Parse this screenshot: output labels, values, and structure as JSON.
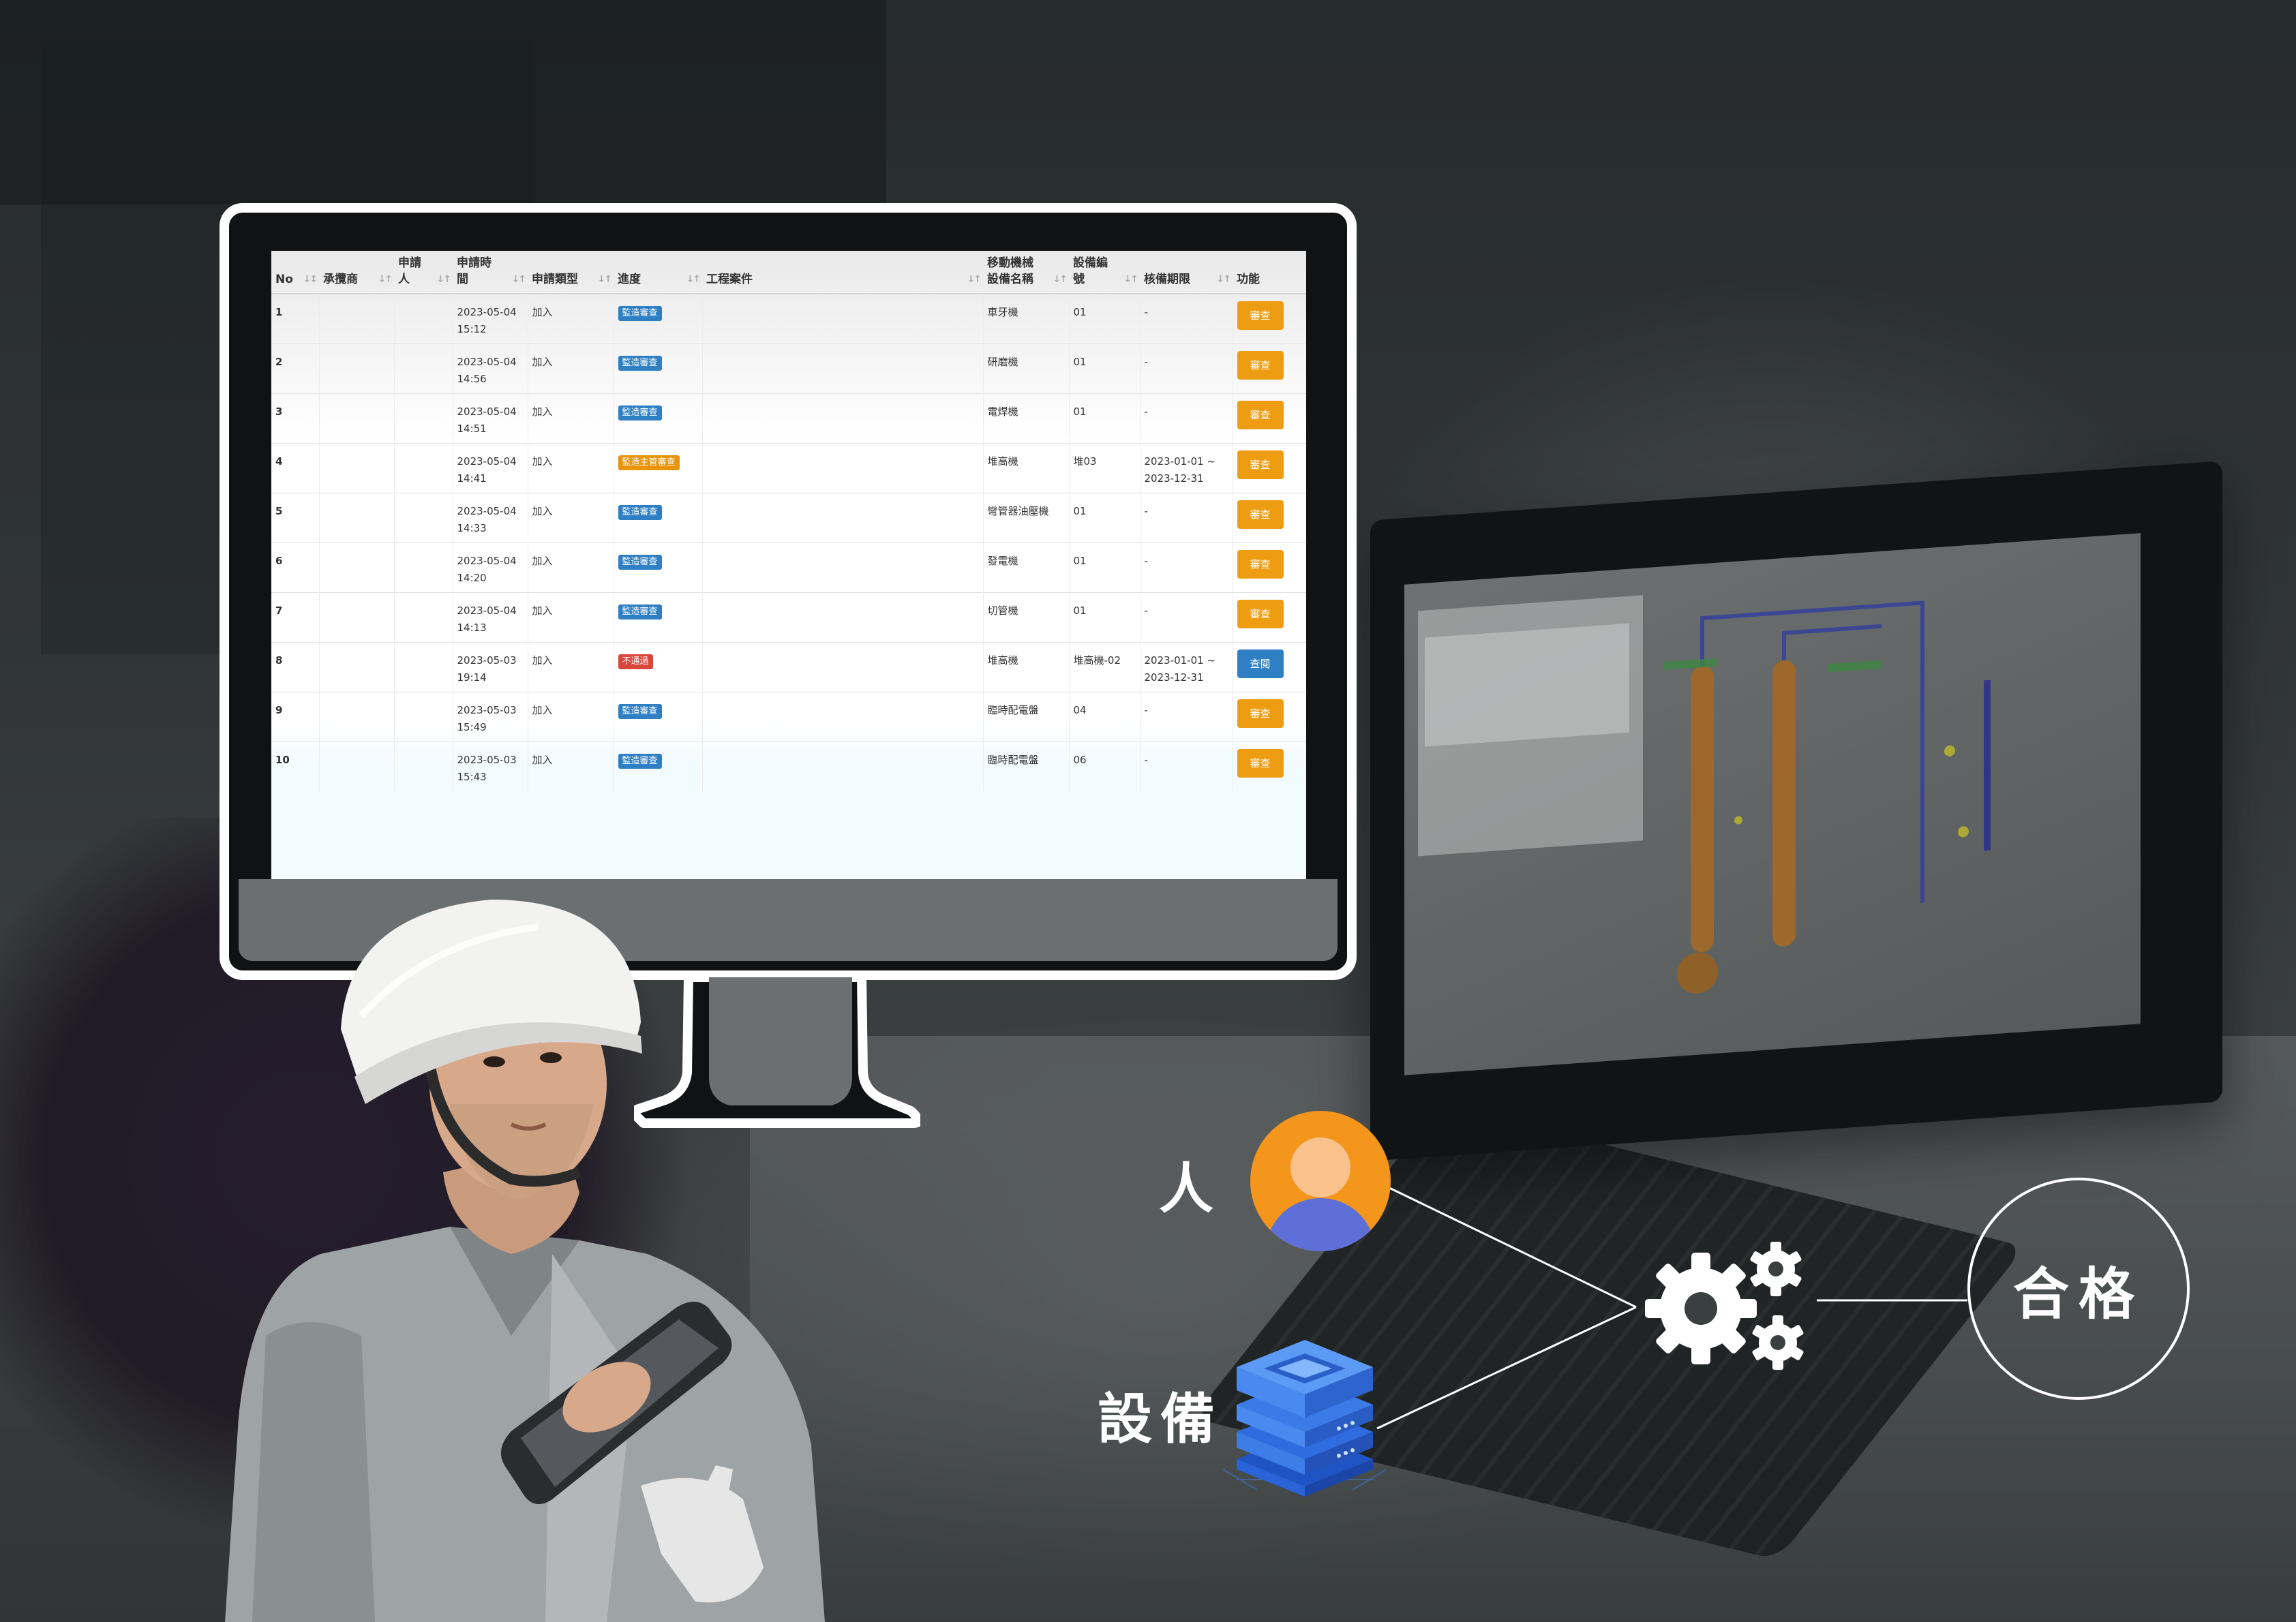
{
  "monitor_table": {
    "headers": {
      "no": "No",
      "contractor": "承攬商",
      "applicant": "申請人",
      "apply_time": "申請時間",
      "apply_type": "申請類型",
      "progress": "進度",
      "project": "工程案件",
      "machine_name": "移動機械設備名稱",
      "equipment_no": "設備編號",
      "validity": "核備期限",
      "function": "功能"
    },
    "rows": [
      {
        "no": "1",
        "date": "2023-05-04",
        "time": "15:12",
        "type": "加入",
        "status": "監造審查",
        "status_color": "blue",
        "machine": "車牙機",
        "equip_no": "01",
        "validity_a": "-",
        "validity_b": "",
        "action": "審查",
        "action_color": "orange"
      },
      {
        "no": "2",
        "date": "2023-05-04",
        "time": "14:56",
        "type": "加入",
        "status": "監造審查",
        "status_color": "blue",
        "machine": "研磨機",
        "equip_no": "01",
        "validity_a": "-",
        "validity_b": "",
        "action": "審查",
        "action_color": "orange"
      },
      {
        "no": "3",
        "date": "2023-05-04",
        "time": "14:51",
        "type": "加入",
        "status": "監造審查",
        "status_color": "blue",
        "machine": "電焊機",
        "equip_no": "01",
        "validity_a": "-",
        "validity_b": "",
        "action": "審查",
        "action_color": "orange"
      },
      {
        "no": "4",
        "date": "2023-05-04",
        "time": "14:41",
        "type": "加入",
        "status": "監造主管審查",
        "status_color": "orange",
        "machine": "堆高機",
        "equip_no": "堆03",
        "validity_a": "2023-01-01 ~",
        "validity_b": "2023-12-31",
        "action": "審查",
        "action_color": "orange"
      },
      {
        "no": "5",
        "date": "2023-05-04",
        "time": "14:33",
        "type": "加入",
        "status": "監造審查",
        "status_color": "blue",
        "machine": "彎管器油壓機",
        "equip_no": "01",
        "validity_a": "-",
        "validity_b": "",
        "action": "審查",
        "action_color": "orange"
      },
      {
        "no": "6",
        "date": "2023-05-04",
        "time": "14:20",
        "type": "加入",
        "status": "監造審查",
        "status_color": "blue",
        "machine": "發電機",
        "equip_no": "01",
        "validity_a": "-",
        "validity_b": "",
        "action": "審查",
        "action_color": "orange"
      },
      {
        "no": "7",
        "date": "2023-05-04",
        "time": "14:13",
        "type": "加入",
        "status": "監造審查",
        "status_color": "blue",
        "machine": "切管機",
        "equip_no": "01",
        "validity_a": "-",
        "validity_b": "",
        "action": "審查",
        "action_color": "orange"
      },
      {
        "no": "8",
        "date": "2023-05-03",
        "time": "19:14",
        "type": "加入",
        "status": "不通過",
        "status_color": "red",
        "machine": "堆高機",
        "equip_no": "堆高機-02",
        "validity_a": "2023-01-01 ~",
        "validity_b": "2023-12-31",
        "action": "查閱",
        "action_color": "blue"
      },
      {
        "no": "9",
        "date": "2023-05-03",
        "time": "15:49",
        "type": "加入",
        "status": "監造審查",
        "status_color": "blue",
        "machine": "臨時配電盤",
        "equip_no": "04",
        "validity_a": "-",
        "validity_b": "",
        "action": "審查",
        "action_color": "orange"
      },
      {
        "no": "10",
        "date": "2023-05-03",
        "time": "15:43",
        "type": "加入",
        "status": "監造審查",
        "status_color": "blue",
        "machine": "臨時配電盤",
        "equip_no": "06",
        "validity_a": "-",
        "validity_b": "",
        "action": "審查",
        "action_color": "orange"
      }
    ]
  },
  "diagram": {
    "person_label": "人",
    "equipment_label": "設備",
    "pass_label": "合格",
    "person_icon": "user-avatar-icon",
    "equipment_icon": "server-stack-icon",
    "process_icon": "gears-icon",
    "colors": {
      "avatar_bg": "#f4951c",
      "avatar_body": "#5f6fd8",
      "server_blue": "#3d7de8"
    }
  },
  "colors": {
    "status_blue": "#2f7fc4",
    "status_orange": "#e8940d",
    "status_red": "#d9473c",
    "action_orange": "#ee9c12",
    "action_blue": "#2f7fc4"
  }
}
